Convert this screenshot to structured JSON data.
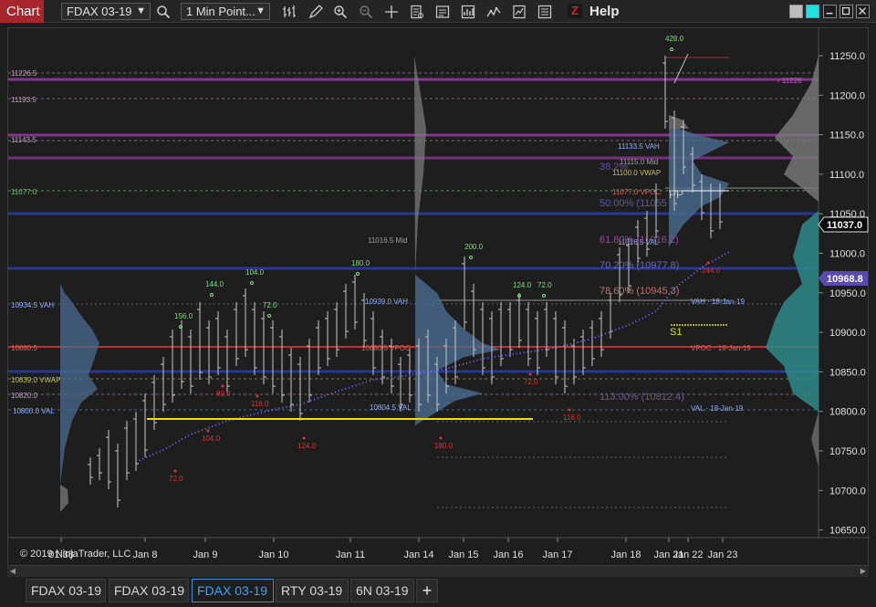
{
  "toolbar": {
    "chart_label": "Chart",
    "instrument": "FDAX 03-19",
    "interval": "1 Min Point...",
    "help_label": "Help",
    "z_label": "Z"
  },
  "chart": {
    "copyright": "© 2019 NinjaTrader, LLC",
    "price_axis": {
      "ticks": [
        "11250.0",
        "11200.0",
        "11150.0",
        "11100.0",
        "11050.0",
        "11000.0",
        "10950.0",
        "10900.0",
        "10850.0",
        "10800.0",
        "10750.0",
        "10700.0",
        "10650.0"
      ],
      "current_price": "11037.0",
      "marker_price": "10968.8"
    },
    "time_axis": [
      "01:38",
      "Jan 8",
      "Jan 9",
      "Jan 10",
      "Jan 11",
      "Jan 14",
      "Jan 15",
      "Jan 16",
      "Jan 17",
      "Jan 18",
      "Jan 21",
      "Jan 22",
      "Jan 23"
    ],
    "level_labels": {
      "l1": "11226.5",
      "l2": "11193.5",
      "l3": "11143.5",
      "l4": "11077.0",
      "l5": "11016.5 Mid",
      "l6": "10934.5 VAH",
      "l7": "10880.5",
      "l8": "10839.0 VWAP",
      "l9": "10820.0",
      "l10": "10800.0 VAL",
      "l11": "10939.0 VAH",
      "l12": "10804.5 VAL",
      "l13": "11133.5 VAH",
      "l14": "11115.0 Mid",
      "l15": "11100.0 VWAP",
      "l16": "11077.0 VPOC",
      "l17": "11016.5 VAL",
      "l18": "VAH · 18-Jan-19",
      "l19": "VPOC · 18-Jan-19",
      "l20": "VAL · 18-Jan-19",
      "l21": "10880.5 VPOC"
    },
    "fib_labels": {
      "f1": "38.2%",
      "f2": "50.00% (11055",
      "f3": "61.80% (11016.2)",
      "f4": "70.20% (10977.8)",
      "f5": "78.60% (10945.3)",
      "f6": "113.00% (10812.4)"
    },
    "pivot_labels": {
      "pp": "PP",
      "s1": "S1",
      "r_right": "‹ 11226"
    },
    "swing_labels": {
      "high": [
        "156.0",
        "144.0",
        "104.0",
        "72.0",
        "180.0",
        "200.0",
        "124.0",
        "72.0",
        "428.0"
      ],
      "low": [
        "72.0",
        "104.0",
        "80.0",
        "116.0",
        "124.0",
        "180.0",
        "72.0",
        "116.0",
        "244.0"
      ]
    }
  },
  "tabs": [
    {
      "label": "FDAX 03-19"
    },
    {
      "label": "FDAX 03-19"
    },
    {
      "label": "FDAX 03-19"
    },
    {
      "label": "RTY 03-19"
    },
    {
      "label": "6N 03-19"
    }
  ],
  "tab_add": "+",
  "colors": {
    "accent_red": "#a8262b",
    "active_tab": "#3ca0ff",
    "vwap_dots": "#7a6cff",
    "yellow_line": "#f0e000",
    "green_label": "#7fe07f",
    "red_label": "#e03030",
    "marker_purple": "#6a5acd"
  }
}
